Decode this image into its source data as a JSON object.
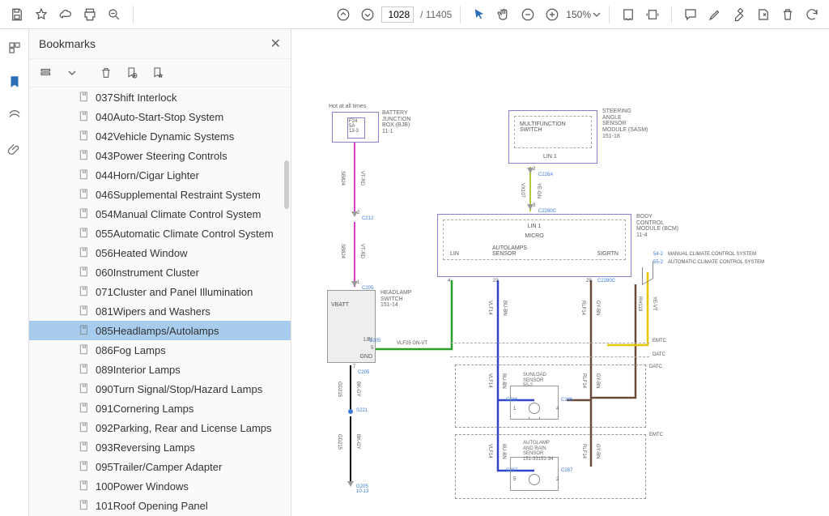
{
  "toolbar": {
    "page_current": "1028",
    "page_total": "/ 11405",
    "zoom": "150%"
  },
  "panel": {
    "title": "Bookmarks",
    "items": [
      {
        "label": "037Shift Interlock"
      },
      {
        "label": "040Auto-Start-Stop System"
      },
      {
        "label": "042Vehicle Dynamic Systems"
      },
      {
        "label": "043Power Steering Controls"
      },
      {
        "label": "044Horn/Cigar Lighter"
      },
      {
        "label": "046Supplemental Restraint System"
      },
      {
        "label": "054Manual Climate Control System"
      },
      {
        "label": "055Automatic Climate Control System"
      },
      {
        "label": "056Heated Window"
      },
      {
        "label": "060Instrument Cluster"
      },
      {
        "label": "071Cluster and Panel Illumination"
      },
      {
        "label": "081Wipers and Washers"
      },
      {
        "label": "085Headlamps/Autolamps"
      },
      {
        "label": "086Fog Lamps"
      },
      {
        "label": "089Interior Lamps"
      },
      {
        "label": "090Turn Signal/Stop/Hazard Lamps"
      },
      {
        "label": "091Cornering Lamps"
      },
      {
        "label": "092Parking, Rear and License Lamps"
      },
      {
        "label": "093Reversing Lamps"
      },
      {
        "label": "095Trailer/Camper Adapter"
      },
      {
        "label": "100Power Windows"
      },
      {
        "label": "101Roof Opening Panel"
      }
    ],
    "active_index": 12
  },
  "diagram": {
    "hot": "Hot at all times",
    "bjb": "BATTERY\nJUNCTION\nBOX (BJB)\n11-1",
    "fuse": "F24\n5A\n13-3",
    "mfs": "MULTIFUNCTION\nSWITCH",
    "sasm": "STEERING\nANGLE\nSENSOR\nMODULE (SASM)\n151-18",
    "lin1a": "LIN 1",
    "bcm": "BODY\nCONTROL\nMODULE (BCM)\n11-4",
    "micro": "MICRO",
    "lin": "LIN",
    "autolamps_sensor": "AUTOLAMPS\nSENSOR",
    "sigrtn": "SIGRTN",
    "manual": "MANUAL CLIMATE CONTROL SYSTEM",
    "auto": "AUTOMATIC CLIMATE CONTROL SYSTEM",
    "m_ref": "54-2",
    "a_ref": "55-2",
    "hls": "HEADLAMP\nSWITCH\n151-14",
    "vbatt": "VBATT",
    "lin2": "LIN",
    "gnd": "GND",
    "sunload": "SUNLOAD\nSENSOR\n55-2",
    "autorain": "AUTOLAMP\nAND RAIN\nSENSOR\n151-33151-34",
    "datc": "DATC",
    "emtc": "EMTC",
    "c212": "C212",
    "c205a": "C205",
    "c205b": "C205",
    "c205c": "C205",
    "c226a": "C226A",
    "c2280c_a": "C2280C",
    "c2280c_b": "C2280C",
    "c286a": "C286",
    "c286b": "C286",
    "c287a": "C287",
    "c287b": "C287",
    "s221": "S221",
    "g205": "G205\n10-13",
    "vlf25": "VLF25   GN-VT",
    "w_vtrd": "VT-RD",
    "w_sb824a": "SB824",
    "w_sb824b": "SB824",
    "w_bkgy": "BK-GY",
    "w_gd215a": "GD215",
    "w_gd215b": "GD215",
    "w_vx107": "VX107",
    "w_yegn": "YE-GN",
    "w_vlf14": "VLF14",
    "w_bubn": "BU-BN",
    "w_rlf14": "RLF14",
    "w_gybn": "GY-BN",
    "w_rh119": "RH119",
    "w_yevt": "YE-VT",
    "p2a": "2",
    "p2b": "2",
    "p1": "1",
    "p5a": "5",
    "p7": "7",
    "p3": "3",
    "p4": "4",
    "p23": "23",
    "p29": "29",
    "p5b": "5",
    "p5c": "5",
    "p1b": "1",
    "p4b": "4",
    "p2c": "2"
  }
}
